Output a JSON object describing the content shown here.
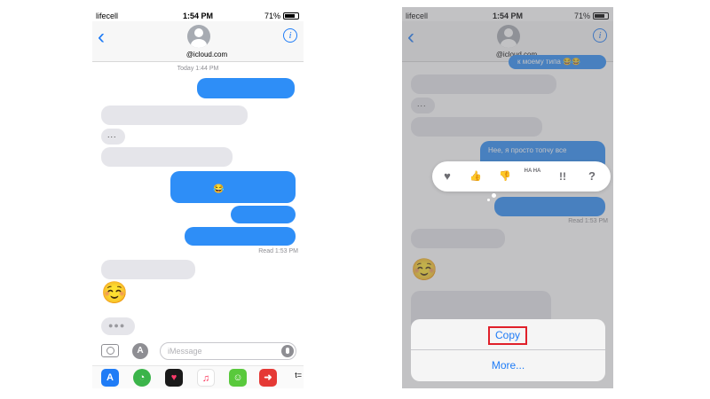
{
  "status_bar": {
    "carrier": "lifecell",
    "time": "1:54 PM",
    "battery": "71%"
  },
  "header": {
    "contact": "@icloud.com",
    "back_icon": "chevron-left-icon",
    "info_icon": "info-icon",
    "info_glyph": "i"
  },
  "conversation": {
    "day_label": "Today 1:44 PM",
    "read_label": "Read 1:53 PM",
    "ellipsis": "...",
    "typing": "●●●",
    "emoji_laugh": "😂",
    "emoji_smile": "☺️",
    "reply_text": "Нее, я просто топчу все",
    "top_snippet": "к моему типа 😂😂"
  },
  "composer": {
    "placeholder": "iMessage",
    "app_store_glyph": "A"
  },
  "app_drawer": {
    "more": "t="
  },
  "tapback": {
    "heart": "♥",
    "like": "👍",
    "dislike": "👎",
    "haha": "HA HA",
    "emphasize": "!!",
    "question": "?"
  },
  "action_sheet": {
    "copy": "Copy",
    "more": "More..."
  },
  "colors": {
    "outgoing": "#2e8ef7",
    "incoming": "#e5e5ea",
    "accent": "#1f7cf6",
    "highlight": "#e0202a"
  }
}
